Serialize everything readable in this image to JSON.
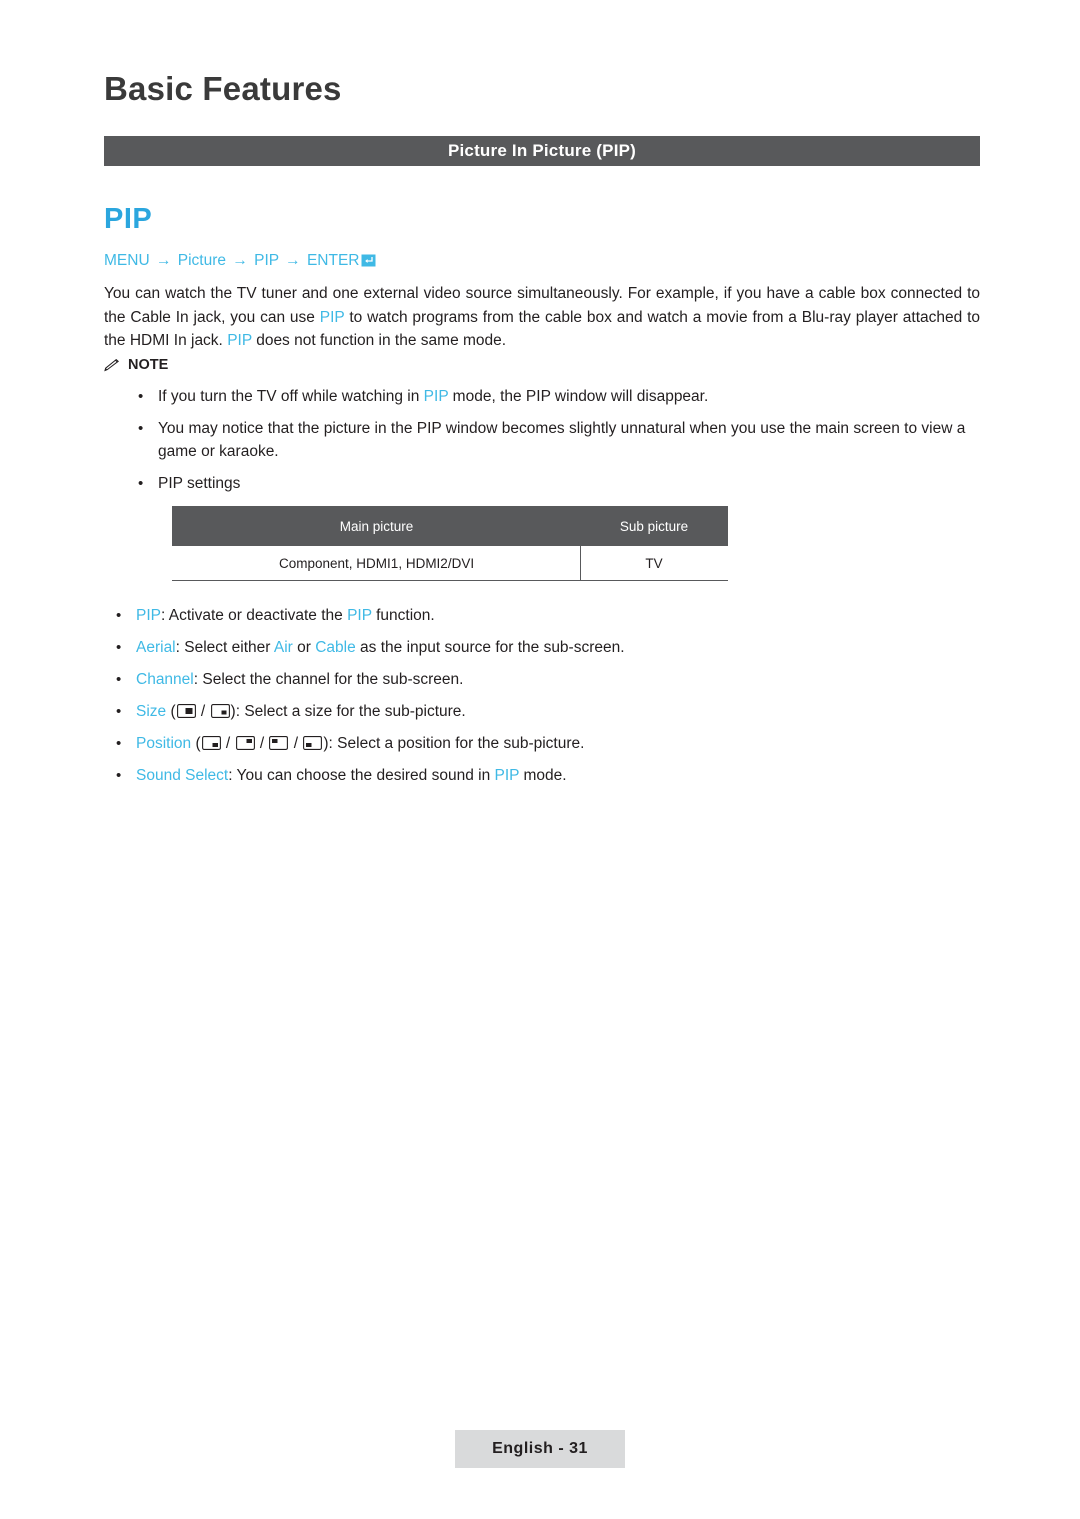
{
  "chapter": {
    "title": "Basic Features"
  },
  "section": {
    "title": "Picture In Picture (PIP)"
  },
  "heading": {
    "text": "PIP"
  },
  "menu_path": {
    "menu": "MENU",
    "arrow": "→",
    "picture": "Picture",
    "pip": "PIP",
    "enter": "ENTER"
  },
  "body": {
    "p1_a": "You can watch the TV tuner and one external video source simultaneously. For example, if you have a cable box connected to the Cable In jack, you can use ",
    "p1_pip1": "PIP",
    "p1_b": " to watch programs from the cable box and watch a movie from a Blu-ray player attached to the HDMI In jack. ",
    "p1_pip2": "PIP",
    "p1_c": " does not function in the same mode."
  },
  "note": {
    "label": "NOTE",
    "items": [
      {
        "a": "If you turn the TV off while watching in ",
        "hl": "PIP",
        "b": " mode, the PIP window will disappear."
      },
      {
        "a": "You may notice that the picture in the PIP window becomes slightly unnatural when you use the main screen to view a game or karaoke.",
        "hl": "",
        "b": ""
      },
      {
        "a": "PIP settings",
        "hl": "",
        "b": ""
      }
    ]
  },
  "table": {
    "headers": [
      "Main picture",
      "Sub picture"
    ],
    "rows": [
      [
        "Component, HDMI1, HDMI2/DVI",
        "TV"
      ]
    ]
  },
  "options": {
    "pip": {
      "label": "PIP",
      "text_a": ": Activate or deactivate the ",
      "hl": "PIP",
      "text_b": " function."
    },
    "aerial": {
      "label": "Aerial",
      "text_a": ": Select either ",
      "hl1": "Air",
      "mid": " or ",
      "hl2": "Cable",
      "text_b": " as the input source for the sub-screen."
    },
    "channel": {
      "label": "Channel",
      "text_a": ": Select the channel for the sub-screen."
    },
    "size": {
      "label": "Size",
      "open": " (",
      "slash": " / ",
      "close": "): Select a size for the sub-picture."
    },
    "position": {
      "label": "Position",
      "open": " (",
      "slash": " / ",
      "close": "): Select a position for the sub-picture."
    },
    "sound": {
      "label": "Sound Select",
      "text_a": ": You can choose the desired sound in ",
      "hl": "PIP",
      "text_b": " mode."
    }
  },
  "footer": {
    "text": "English - 31"
  },
  "colors": {
    "accent": "#3fb9e5",
    "bar": "#58595b",
    "footer_bg": "#d9dadb"
  }
}
